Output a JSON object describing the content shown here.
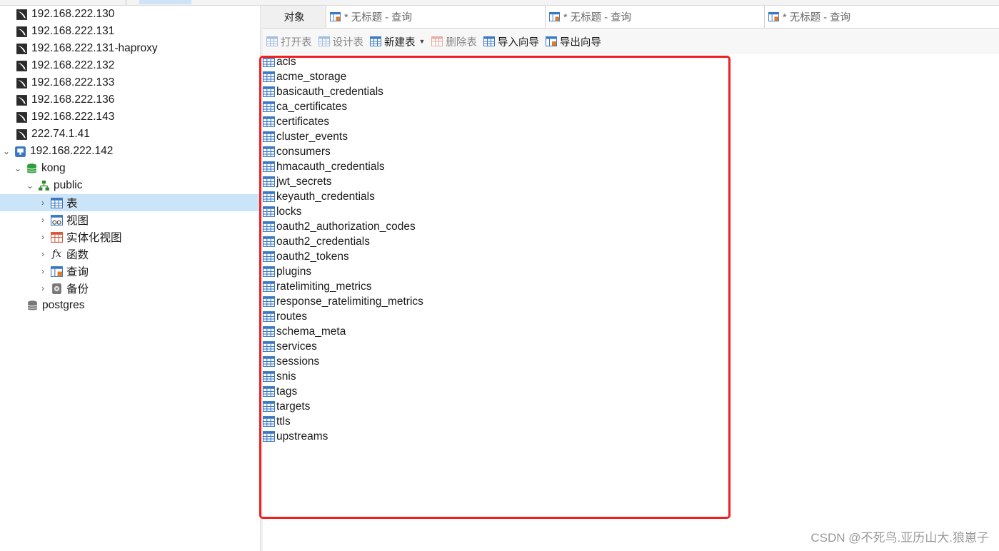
{
  "sidebar": {
    "connections": [
      {
        "label": "192.168.222.130",
        "icon": "mysql-connection-icon"
      },
      {
        "label": "192.168.222.131",
        "icon": "mysql-connection-icon"
      },
      {
        "label": "192.168.222.131-haproxy",
        "icon": "mysql-connection-icon"
      },
      {
        "label": "192.168.222.132",
        "icon": "mysql-connection-icon"
      },
      {
        "label": "192.168.222.133",
        "icon": "mysql-connection-icon"
      },
      {
        "label": "192.168.222.136",
        "icon": "mysql-connection-icon"
      },
      {
        "label": "192.168.222.143",
        "icon": "mysql-connection-icon"
      },
      {
        "label": "222.74.1.41",
        "icon": "mysql-connection-icon"
      },
      {
        "label": "192.168.222.142",
        "icon": "postgresql-connection-icon"
      }
    ],
    "database": {
      "label": "kong",
      "icon": "database-icon"
    },
    "schema": {
      "label": "public",
      "icon": "schema-icon"
    },
    "schema_items": [
      {
        "label": "表",
        "icon": "table-icon"
      },
      {
        "label": "视图",
        "icon": "view-icon"
      },
      {
        "label": "实体化视图",
        "icon": "materialized-view-icon"
      },
      {
        "label": "函数",
        "icon": "function-icon"
      },
      {
        "label": "查询",
        "icon": "query-icon"
      },
      {
        "label": "备份",
        "icon": "backup-icon"
      }
    ],
    "database2": {
      "label": "postgres",
      "icon": "database-icon"
    }
  },
  "tabs": {
    "objects": "对象",
    "queries": [
      "* 无标题 - 查询",
      "* 无标题 - 查询",
      "* 无标题 - 查询"
    ]
  },
  "toolbar": {
    "open_table": "打开表",
    "design_table": "设计表",
    "new_table": "新建表",
    "delete_table": "删除表",
    "import_wizard": "导入向导",
    "export_wizard": "导出向导"
  },
  "tables": [
    "acls",
    "acme_storage",
    "basicauth_credentials",
    "ca_certificates",
    "certificates",
    "cluster_events",
    "consumers",
    "hmacauth_credentials",
    "jwt_secrets",
    "keyauth_credentials",
    "locks",
    "oauth2_authorization_codes",
    "oauth2_credentials",
    "oauth2_tokens",
    "plugins",
    "ratelimiting_metrics",
    "response_ratelimiting_metrics",
    "routes",
    "schema_meta",
    "services",
    "sessions",
    "snis",
    "tags",
    "targets",
    "ttls",
    "upstreams"
  ],
  "watermark": "CSDN @不死鸟.亚历山大.狼崽子",
  "colors": {
    "highlight": "#f02020",
    "selection": "#cce4f7",
    "accent": "#1e6fbf"
  }
}
